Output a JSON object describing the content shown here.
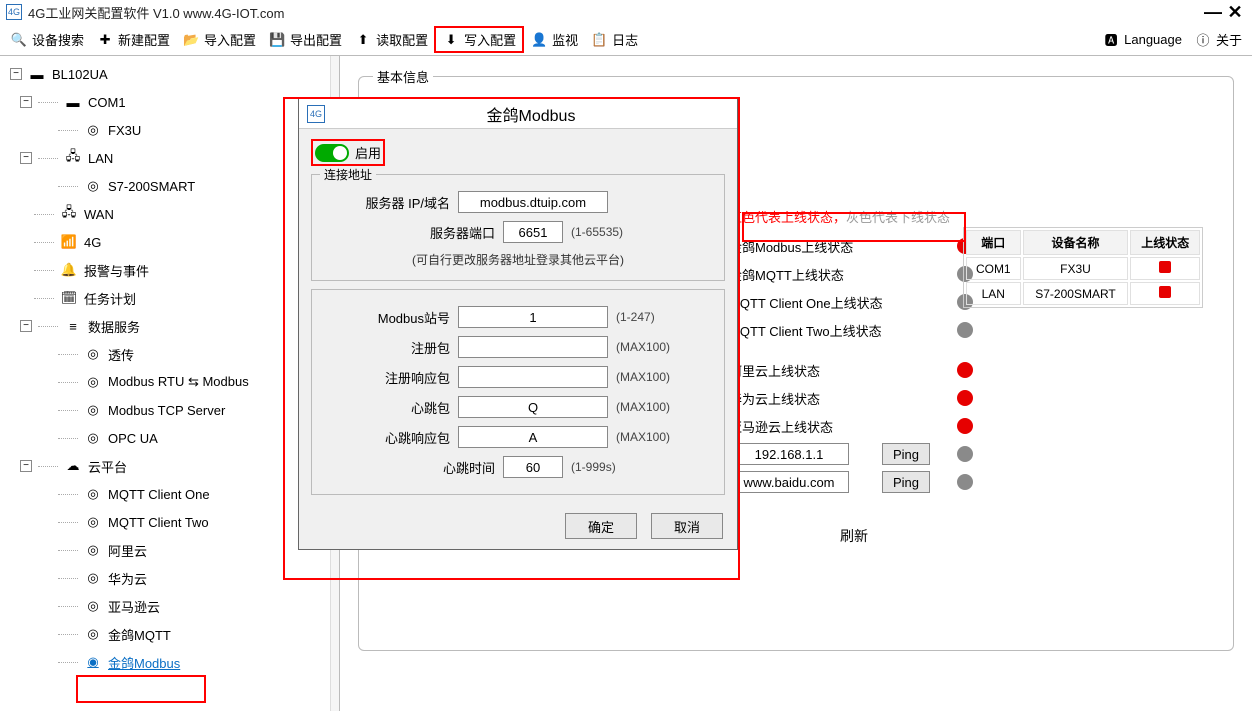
{
  "window": {
    "title": "4G工业网关配置软件 V1.0 www.4G-IOT.com",
    "minimize": "—",
    "close": "✕"
  },
  "toolbar": {
    "search": "设备搜索",
    "new": "新建配置",
    "import": "导入配置",
    "export": "导出配置",
    "read": "读取配置",
    "write": "写入配置",
    "monitor": "监视",
    "log": "日志",
    "language": "Language",
    "about": "关于"
  },
  "tree": {
    "root": "BL102UA",
    "com1": "COM1",
    "fx3u": "FX3U",
    "lan": "LAN",
    "s7": "S7-200SMART",
    "wan": "WAN",
    "fourg": "4G",
    "alarm": "报警与事件",
    "task": "任务计划",
    "dataservice": "数据服务",
    "passthrough": "透传",
    "mrtu": "Modbus RTU ⇆ Modbus",
    "mtcp": "Modbus TCP Server",
    "opc": "OPC UA",
    "cloud": "云平台",
    "mqtt1": "MQTT Client One",
    "mqtt2": "MQTT Client Two",
    "ali": "阿里云",
    "huawei": "华为云",
    "aws": "亚马逊云",
    "jgmqtt": "金鸽MQTT",
    "jgmodbus": "金鸽Modbus"
  },
  "tab": {
    "basic": "基本信息"
  },
  "status": {
    "hint_red": "红色代表上线状态，",
    "hint_grey": "灰色代表下线状态",
    "rows": [
      {
        "label": "金鸽Modbus上线状态",
        "state": "red"
      },
      {
        "label": "金鸽MQTT上线状态",
        "state": "grey"
      },
      {
        "label": "MQTT Client One上线状态",
        "state": "grey"
      },
      {
        "label": "MQTT Client Two上线状态",
        "state": "grey"
      },
      {
        "label": "阿里云上线状态",
        "state": "red"
      },
      {
        "label": "华为云上线状态",
        "state": "red"
      },
      {
        "label": "亚马逊云上线状态",
        "state": "red"
      }
    ],
    "ip": "192.168.1.1",
    "ping": "Ping",
    "domain": "www.baidu.com",
    "refresh": "刷新"
  },
  "device_table": {
    "h1": "端口",
    "h2": "设备名称",
    "h3": "上线状态",
    "rows": [
      {
        "port": "COM1",
        "name": "FX3U"
      },
      {
        "port": "LAN",
        "name": "S7-200SMART"
      }
    ]
  },
  "modal": {
    "title": "金鸽Modbus",
    "enable": "启用",
    "addr_legend": "连接地址",
    "server_ip_label": "服务器 IP/域名",
    "server_ip": "modbus.dtuip.com",
    "server_port_label": "服务器端口",
    "server_port": "6651",
    "server_port_hint": "(1-65535)",
    "note": "(可自行更改服务器地址登录其他云平台)",
    "station_label": "Modbus站号",
    "station": "1",
    "station_hint": "(1-247)",
    "reg_label": "注册包",
    "reg": "",
    "reg_hint": "(MAX100)",
    "regresp_label": "注册响应包",
    "regresp": "",
    "regresp_hint": "(MAX100)",
    "hb_label": "心跳包",
    "hb": "Q",
    "hb_hint": "(MAX100)",
    "hbresp_label": "心跳响应包",
    "hbresp": "A",
    "hbresp_hint": "(MAX100)",
    "hbtime_label": "心跳时间",
    "hbtime": "60",
    "hbtime_hint": "(1-999s)",
    "ok": "确定",
    "cancel": "取消"
  }
}
